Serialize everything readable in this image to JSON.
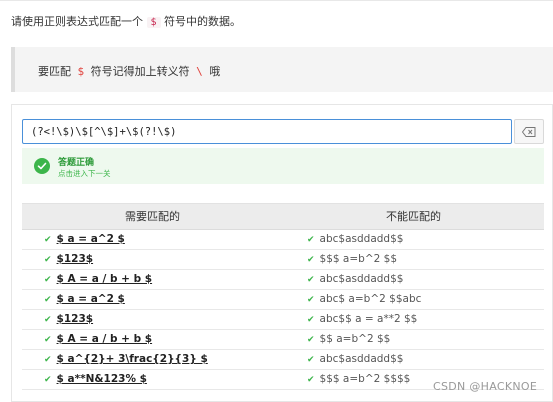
{
  "prompt": {
    "before": "请使用正则表达式匹配一个",
    "symbol": "$",
    "after": "符号中的数据。"
  },
  "hint": {
    "before": "要匹配",
    "dollar": "$",
    "middle": "符号记得加上转义符",
    "backslash": "\\",
    "after": "哦"
  },
  "regex_input": {
    "value": "(?<!\\$)\\$[^\\$]+\\$(?!\\$)"
  },
  "result": {
    "title": "答题正确",
    "subtitle": "点击进入下一关"
  },
  "table": {
    "headers": [
      "需要匹配的",
      "不能匹配的"
    ],
    "rows": [
      {
        "match": "$ a = a^2 $",
        "nomatch": "abc$asddadd$$"
      },
      {
        "match": "$123$",
        "nomatch": "$$$ a=b^2 $$"
      },
      {
        "match": "$ A = a / b + b $",
        "nomatch": "abc$asddadd$$"
      },
      {
        "match": "$ a = a^2 $",
        "nomatch": "abc$ a=b^2 $$abc"
      },
      {
        "match": "$123$",
        "nomatch": "abc$$ a = a**2 $$"
      },
      {
        "match": "$ A = a / b + b $",
        "nomatch": "$$ a=b^2 $$"
      },
      {
        "match": "$ a^{2}+ 3\\frac{2}{3} $",
        "nomatch": "abc$asddadd$$"
      },
      {
        "match": "$ a**N&123% $",
        "nomatch": "$$$ a=b^2 $$$$"
      }
    ]
  },
  "watermark": "CSDN @HACKNOE",
  "colors": {
    "success": "#3cb54a",
    "input_border": "#4a90d9",
    "code_red": "#e0413b"
  },
  "icons": {
    "clear": "backspace-icon",
    "success": "check-circle-icon",
    "row_check": "check-icon"
  }
}
